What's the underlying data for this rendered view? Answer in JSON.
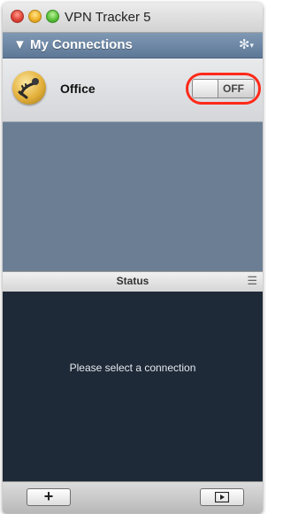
{
  "window": {
    "title": "VPN Tracker 5"
  },
  "sidebar": {
    "section_title": "▼ My Connections",
    "gear_icon": "gear-icon",
    "connections": [
      {
        "name": "Office",
        "toggle_state": "OFF"
      }
    ]
  },
  "status": {
    "header": "Status",
    "message": "Please select a connection"
  },
  "toolbar": {
    "add_label": "+",
    "play_icon": "play-icon"
  },
  "colors": {
    "section_header": "#6f88a6",
    "list_background": "#6b7e94",
    "status_background": "#1f2a38",
    "highlight_ring": "#ff2a1a"
  }
}
